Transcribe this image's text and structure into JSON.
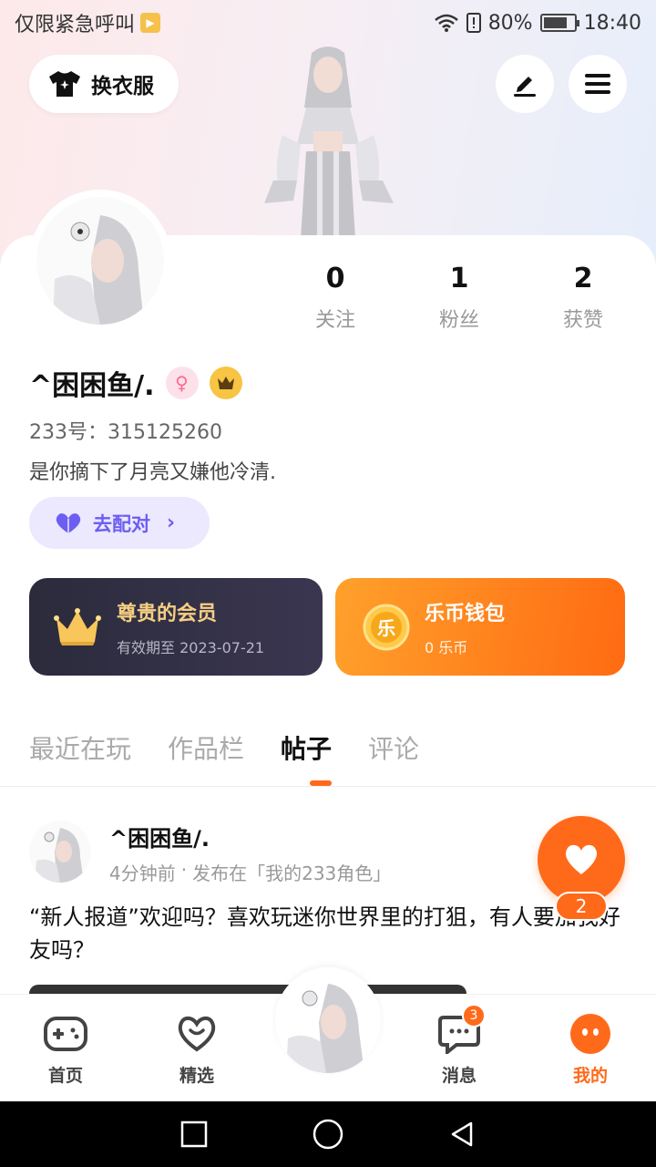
{
  "status_bar": {
    "left_text": "仅限紧急呼叫",
    "battery": "80%",
    "battery_level": 0.8,
    "time": "18:40"
  },
  "header": {
    "outfit_label": "换衣服"
  },
  "profile": {
    "stats": [
      {
        "value": "0",
        "label": "关注"
      },
      {
        "value": "1",
        "label": "粉丝"
      },
      {
        "value": "2",
        "label": "获赞"
      }
    ],
    "username": "^困困鱼/.",
    "uid": "233号：315125260",
    "signature": "是你摘下了月亮又嫌他冷清.",
    "pair_label": "去配对"
  },
  "cards": {
    "vip": {
      "title": "尊贵的会员",
      "subtitle": "有效期至 2023-07-21"
    },
    "coin": {
      "title": "乐币钱包",
      "subtitle": "0 乐币",
      "icon_char": "乐"
    }
  },
  "tabs": [
    {
      "label": "最近在玩",
      "active": false
    },
    {
      "label": "作品栏",
      "active": false
    },
    {
      "label": "帖子",
      "active": true
    },
    {
      "label": "评论",
      "active": false
    }
  ],
  "post": {
    "author": "^困困鱼/.",
    "time": "4分钟前",
    "separator": "·",
    "location": "发布在「我的233角色」",
    "text": "“新人报道”欢迎吗？喜欢玩迷你世界里的打狙，有人要加我好友吗？"
  },
  "like": {
    "count": "2"
  },
  "bottom_nav": [
    {
      "label": "首页",
      "icon": "gamepad-icon",
      "active": false
    },
    {
      "label": "精选",
      "icon": "heart-outline-icon",
      "active": false
    },
    {
      "label": "消息",
      "icon": "chat-icon",
      "active": false,
      "badge": "3"
    },
    {
      "label": "我的",
      "icon": "profile-face-icon",
      "active": true
    }
  ],
  "colors": {
    "accent": "#ff6a1a",
    "vip_gold": "#f6cf84",
    "pair_purple": "#6c5ef2"
  }
}
